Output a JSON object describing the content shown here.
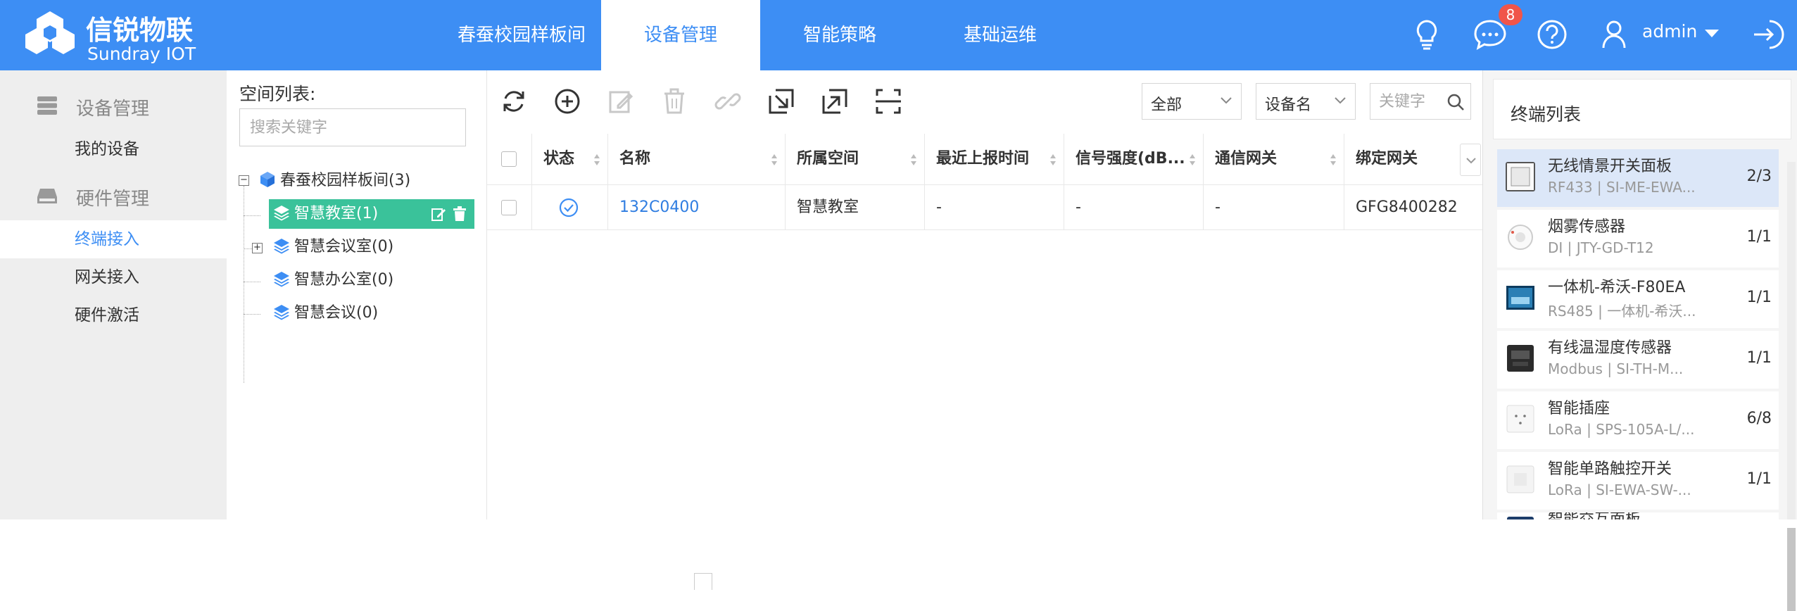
{
  "header": {
    "logo_name": "信锐物联",
    "logo_sub": "Sundray IOT",
    "nav": [
      {
        "label": "春蚕校园样板间"
      },
      {
        "label": "设备管理"
      },
      {
        "label": "智能策略"
      },
      {
        "label": "基础运维"
      }
    ],
    "notification_count": "8",
    "user_name": "admin"
  },
  "sidebar": {
    "group1_label": "设备管理",
    "group1_items": [
      {
        "label": "我的设备"
      }
    ],
    "group2_label": "硬件管理",
    "group2_items": [
      {
        "label": "终端接入"
      },
      {
        "label": "网关接入"
      },
      {
        "label": "硬件激活"
      }
    ]
  },
  "space_tree": {
    "title": "空间列表:",
    "search_placeholder": "搜索关键字",
    "root": "春蚕校园样板间(3)",
    "children": [
      {
        "label": "智慧教室(1)"
      },
      {
        "label": "智慧会议室(0)"
      },
      {
        "label": "智慧办公室(0)"
      },
      {
        "label": "智慧会议(0)"
      }
    ]
  },
  "toolbar": {
    "filter_scope": "全部",
    "filter_field": "设备名",
    "keyword_placeholder": "关键字"
  },
  "table": {
    "columns": [
      "状态",
      "名称",
      "所属空间",
      "最近上报时间",
      "信号强度(dB...",
      "通信网关",
      "绑定网关"
    ],
    "rows": [
      {
        "name": "132C0400",
        "space": "智慧教室",
        "last_report": "-",
        "signal": "-",
        "comm_gateway": "-",
        "bind_gateway": "GFG8400282"
      }
    ]
  },
  "terminal_list": {
    "title": "终端列表",
    "items": [
      {
        "name": "无线情景开关面板",
        "sub": "RF433 | SI-ME-EWA...",
        "count": "2/3"
      },
      {
        "name": "烟雾传感器",
        "sub": "DI | JTY-GD-T12",
        "count": "1/1"
      },
      {
        "name": "一体机-希沃-F80EA",
        "sub": "RS485 | 一体机-希沃...",
        "count": "1/1"
      },
      {
        "name": "有线温湿度传感器",
        "sub": "Modbus | SI-TH-M...",
        "count": "1/1"
      },
      {
        "name": "智能插座",
        "sub": "LoRa | SPS-105A-L/...",
        "count": "6/8"
      },
      {
        "name": "智能单路触控开关",
        "sub": "LoRa | SI-EWA-SW-...",
        "count": "1/1"
      },
      {
        "name": "智能交互面板",
        "sub": "",
        "count": ""
      }
    ]
  },
  "colors": {
    "brand_blue": "#3d8ef4",
    "selected_green": "#3ac29a",
    "badge_red": "#f0554a",
    "active_terminal": "#dce7f8"
  }
}
